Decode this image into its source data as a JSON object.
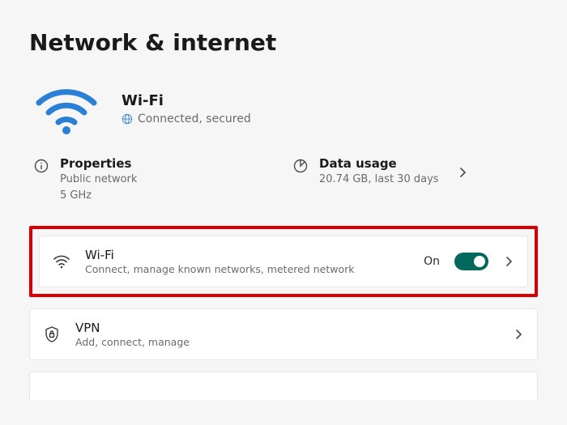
{
  "page": {
    "title": "Network & internet"
  },
  "connection": {
    "name": "Wi-Fi",
    "status": "Connected, secured"
  },
  "properties": {
    "title": "Properties",
    "network_type": "Public network",
    "band": "5 GHz"
  },
  "usage": {
    "title": "Data usage",
    "detail": "20.74 GB, last 30 days"
  },
  "wifi_row": {
    "title": "Wi-Fi",
    "subtitle": "Connect, manage known networks, metered network",
    "toggle_label": "On",
    "toggle_on": true
  },
  "vpn_row": {
    "title": "VPN",
    "subtitle": "Add, connect, manage"
  }
}
